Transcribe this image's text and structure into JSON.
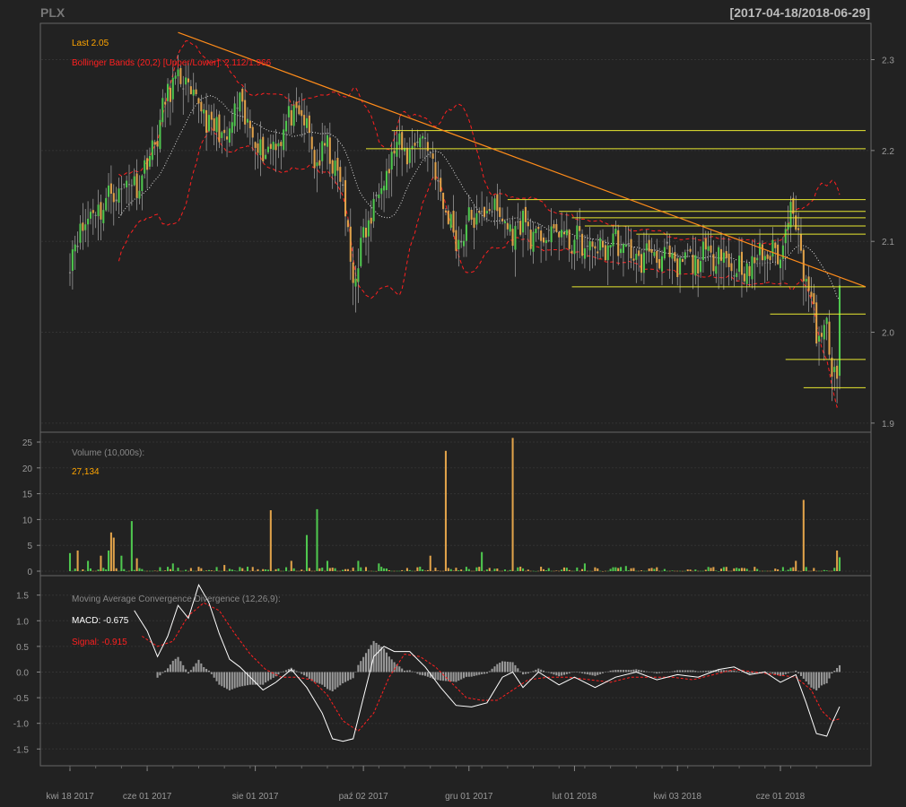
{
  "header": {
    "symbol": "PLX",
    "date_range": "[2017-04-18/2018-06-29]"
  },
  "colors": {
    "background": "#222222",
    "panel_border": "#666666",
    "up": "#4fc74f",
    "down": "#e0a24a",
    "flat": "#999999",
    "bbands": "#ff2020",
    "sma": "#dddddd",
    "trendline": "#ff8c1a",
    "support": "#e8e830",
    "macd": "#ffffff",
    "signal": "#ff2020",
    "histogram": "#999999",
    "last_label": "#ffa500"
  },
  "chart_data": [
    {
      "type": "candlestick",
      "title": "",
      "legend": {
        "last_label": "Last 2.05",
        "bbands_label": "Bollinger Bands (20,2) [Upper/Lower]: 2.112/1.966"
      },
      "y_ticks": [
        "2.3",
        "2.2",
        "2.1",
        "2.0",
        "1.9"
      ],
      "ylim": [
        1.89,
        2.34
      ],
      "x_ticks": [
        "kwi 18 2017",
        "cze 01 2017",
        "sie 01 2017",
        "paź 02 2017",
        "gru 01 2017",
        "lut 01 2018",
        "kwi 03 2018",
        "cze 01 2018"
      ],
      "x_tick_index": [
        0,
        30,
        72,
        114,
        155,
        196,
        236,
        276
      ],
      "n_bars": 300,
      "close_path": {
        "index": [
          0,
          5,
          12,
          20,
          28,
          34,
          40,
          45,
          52,
          60,
          66,
          72,
          78,
          84,
          90,
          95,
          100,
          105,
          110,
          114,
          120,
          126,
          132,
          138,
          144,
          150,
          155,
          160,
          165,
          170,
          176,
          182,
          188,
          196,
          204,
          212,
          220,
          228,
          236,
          240,
          246,
          252,
          258,
          264,
          270,
          276,
          280,
          284,
          288,
          290,
          292,
          294,
          296,
          298,
          299
        ],
        "close": [
          2.08,
          2.12,
          2.14,
          2.16,
          2.17,
          2.22,
          2.28,
          2.27,
          2.24,
          2.21,
          2.25,
          2.21,
          2.2,
          2.23,
          2.24,
          2.19,
          2.2,
          2.17,
          2.06,
          2.1,
          2.16,
          2.2,
          2.2,
          2.22,
          2.15,
          2.1,
          2.12,
          2.13,
          2.14,
          2.11,
          2.12,
          2.1,
          2.11,
          2.1,
          2.09,
          2.1,
          2.08,
          2.09,
          2.07,
          2.08,
          2.08,
          2.09,
          2.07,
          2.07,
          2.09,
          2.08,
          2.15,
          2.09,
          2.03,
          2.0,
          1.99,
          2.01,
          1.95,
          1.95,
          2.05
        ]
      },
      "trendline": {
        "start": [
          42,
          2.33
        ],
        "end": [
          310,
          2.05
        ]
      },
      "support_lines": [
        {
          "from": 125,
          "to": 310,
          "y": 2.222
        },
        {
          "from": 115,
          "to": 310,
          "y": 2.202
        },
        {
          "from": 170,
          "to": 310,
          "y": 2.146
        },
        {
          "from": 190,
          "to": 310,
          "y": 2.133
        },
        {
          "from": 195,
          "to": 310,
          "y": 2.126
        },
        {
          "from": 200,
          "to": 310,
          "y": 2.117
        },
        {
          "from": 220,
          "to": 310,
          "y": 2.108
        },
        {
          "from": 195,
          "to": 310,
          "y": 2.05
        },
        {
          "from": 272,
          "to": 310,
          "y": 2.02
        },
        {
          "from": 278,
          "to": 310,
          "y": 1.97
        },
        {
          "from": 285,
          "to": 310,
          "y": 1.939
        }
      ]
    },
    {
      "type": "bar",
      "title": "Volume (10,000s):",
      "last_value": "27,134",
      "y_ticks": [
        "25",
        "20",
        "15",
        "10",
        "5",
        "0"
      ],
      "ylim": [
        0,
        26
      ],
      "spikes": [
        {
          "index": 0,
          "value": 3.5
        },
        {
          "index": 3,
          "value": 4
        },
        {
          "index": 7,
          "value": 2
        },
        {
          "index": 12,
          "value": 3
        },
        {
          "index": 15,
          "value": 4
        },
        {
          "index": 16,
          "value": 7.5
        },
        {
          "index": 17,
          "value": 6.5
        },
        {
          "index": 20,
          "value": 3
        },
        {
          "index": 24,
          "value": 9.7
        },
        {
          "index": 26,
          "value": 2.5
        },
        {
          "index": 40,
          "value": 1.5
        },
        {
          "index": 60,
          "value": 1.2
        },
        {
          "index": 78,
          "value": 11.8
        },
        {
          "index": 86,
          "value": 2
        },
        {
          "index": 92,
          "value": 7
        },
        {
          "index": 96,
          "value": 12
        },
        {
          "index": 100,
          "value": 2
        },
        {
          "index": 112,
          "value": 2
        },
        {
          "index": 120,
          "value": 1.5
        },
        {
          "index": 140,
          "value": 3
        },
        {
          "index": 146,
          "value": 23.3
        },
        {
          "index": 160,
          "value": 3.7
        },
        {
          "index": 172,
          "value": 25.8
        },
        {
          "index": 200,
          "value": 1.5
        },
        {
          "index": 216,
          "value": 1
        },
        {
          "index": 250,
          "value": 0.8
        },
        {
          "index": 285,
          "value": 13.8
        },
        {
          "index": 282,
          "value": 2
        },
        {
          "index": 298,
          "value": 4
        },
        {
          "index": 299,
          "value": 2.7
        }
      ]
    },
    {
      "type": "line",
      "title": "Moving Average Convergence Divergence (12,26,9):",
      "series": [
        {
          "name": "MACD: -0.675",
          "color": "#ffffff"
        },
        {
          "name": "Signal: -0.915",
          "color": "#ff2020"
        }
      ],
      "y_ticks": [
        "1.5",
        "1.0",
        "0.5",
        "0.0",
        "-0.5",
        "-1.0",
        "-1.5"
      ],
      "ylim": [
        -1.85,
        1.75
      ],
      "macd_path": {
        "index": [
          25,
          30,
          34,
          38,
          42,
          46,
          50,
          54,
          58,
          62,
          66,
          70,
          75,
          80,
          86,
          92,
          98,
          102,
          106,
          110,
          114,
          118,
          122,
          126,
          132,
          138,
          144,
          150,
          156,
          162,
          168,
          172,
          176,
          182,
          190,
          196,
          204,
          212,
          220,
          228,
          236,
          244,
          252,
          258,
          264,
          270,
          276,
          282,
          286,
          290,
          294,
          296,
          299
        ],
        "value": [
          1.2,
          0.8,
          0.3,
          0.7,
          1.3,
          1.05,
          1.7,
          1.35,
          0.75,
          0.25,
          0.1,
          -0.1,
          -0.35,
          -0.2,
          0.05,
          -0.3,
          -0.8,
          -1.3,
          -1.35,
          -1.3,
          -0.5,
          0.3,
          0.5,
          0.4,
          0.4,
          0.1,
          -0.3,
          -0.65,
          -0.68,
          -0.6,
          -0.1,
          0.0,
          -0.3,
          0.0,
          -0.25,
          -0.1,
          -0.3,
          -0.1,
          0.0,
          -0.15,
          -0.05,
          -0.1,
          0.05,
          0.1,
          -0.05,
          0.0,
          -0.2,
          -0.05,
          -0.6,
          -1.2,
          -1.25,
          -1.0,
          -0.675
        ]
      },
      "signal_path": {
        "index": [
          28,
          34,
          40,
          46,
          52,
          58,
          64,
          70,
          76,
          82,
          88,
          94,
          100,
          106,
          112,
          118,
          124,
          130,
          136,
          142,
          148,
          154,
          160,
          166,
          172,
          178,
          186,
          194,
          202,
          210,
          218,
          226,
          234,
          242,
          250,
          258,
          266,
          274,
          282,
          288,
          292,
          296,
          299
        ],
        "value": [
          0.7,
          0.5,
          0.6,
          1.1,
          1.35,
          1.2,
          0.75,
          0.35,
          0.05,
          -0.1,
          -0.1,
          -0.15,
          -0.45,
          -0.95,
          -1.15,
          -0.8,
          -0.1,
          0.35,
          0.3,
          0.1,
          -0.2,
          -0.5,
          -0.55,
          -0.55,
          -0.35,
          -0.15,
          -0.1,
          -0.1,
          -0.15,
          -0.2,
          -0.1,
          -0.1,
          -0.1,
          -0.15,
          -0.05,
          0.05,
          0.0,
          -0.05,
          -0.1,
          -0.35,
          -0.75,
          -0.95,
          -0.915
        ]
      }
    }
  ]
}
